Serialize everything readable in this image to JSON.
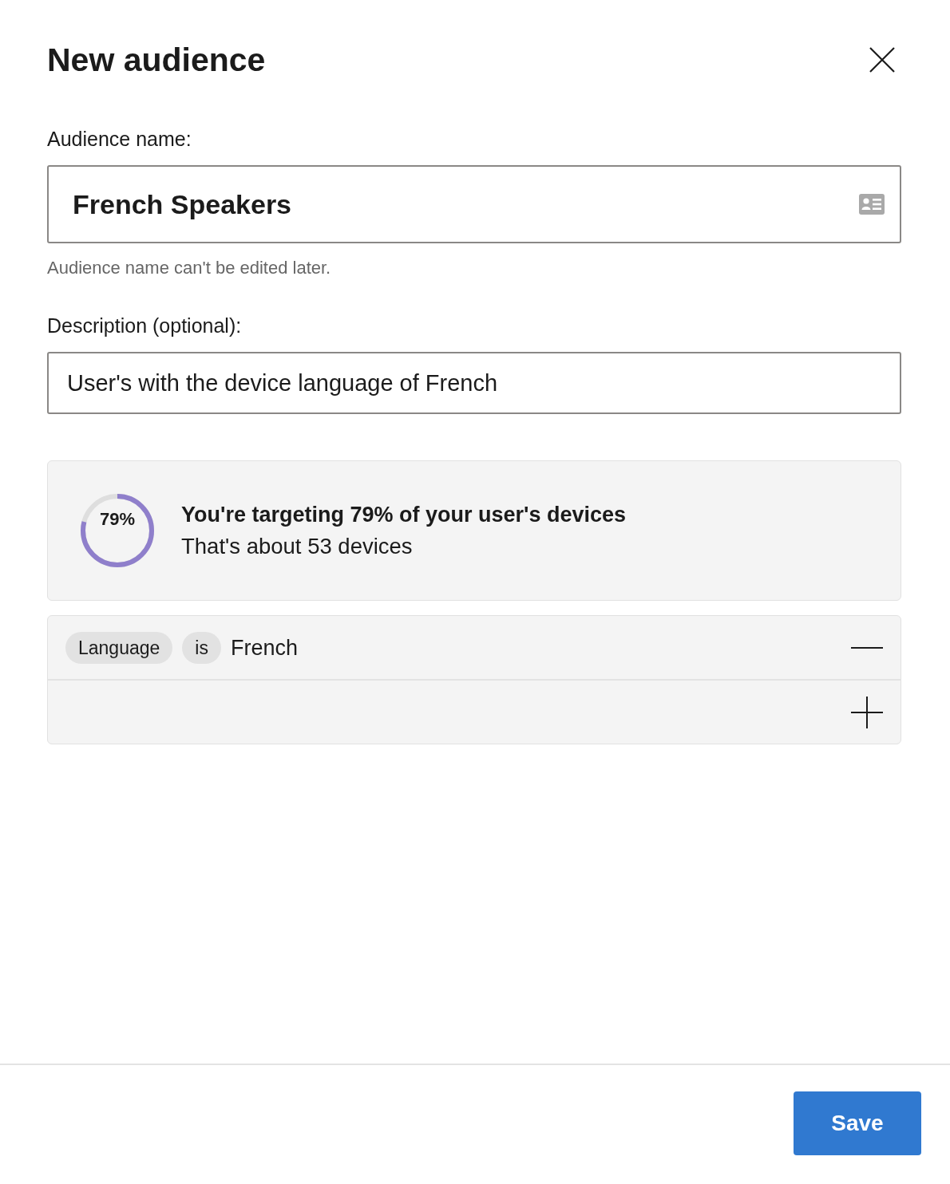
{
  "dialog": {
    "title": "New audience"
  },
  "name_field": {
    "label": "Audience name:",
    "value": "French Speakers",
    "hint": "Audience name can't be edited later."
  },
  "description_field": {
    "label": "Description (optional):",
    "value": "User's with the device language of French"
  },
  "reach": {
    "percent": "79%",
    "level": 0.79,
    "headline": "You're targeting 79% of your user's devices",
    "detail": "That's about 53 devices"
  },
  "conditions": [
    {
      "attribute": "Language",
      "operator": "is",
      "value": "French"
    }
  ],
  "save_button": {
    "label": "Save"
  }
}
